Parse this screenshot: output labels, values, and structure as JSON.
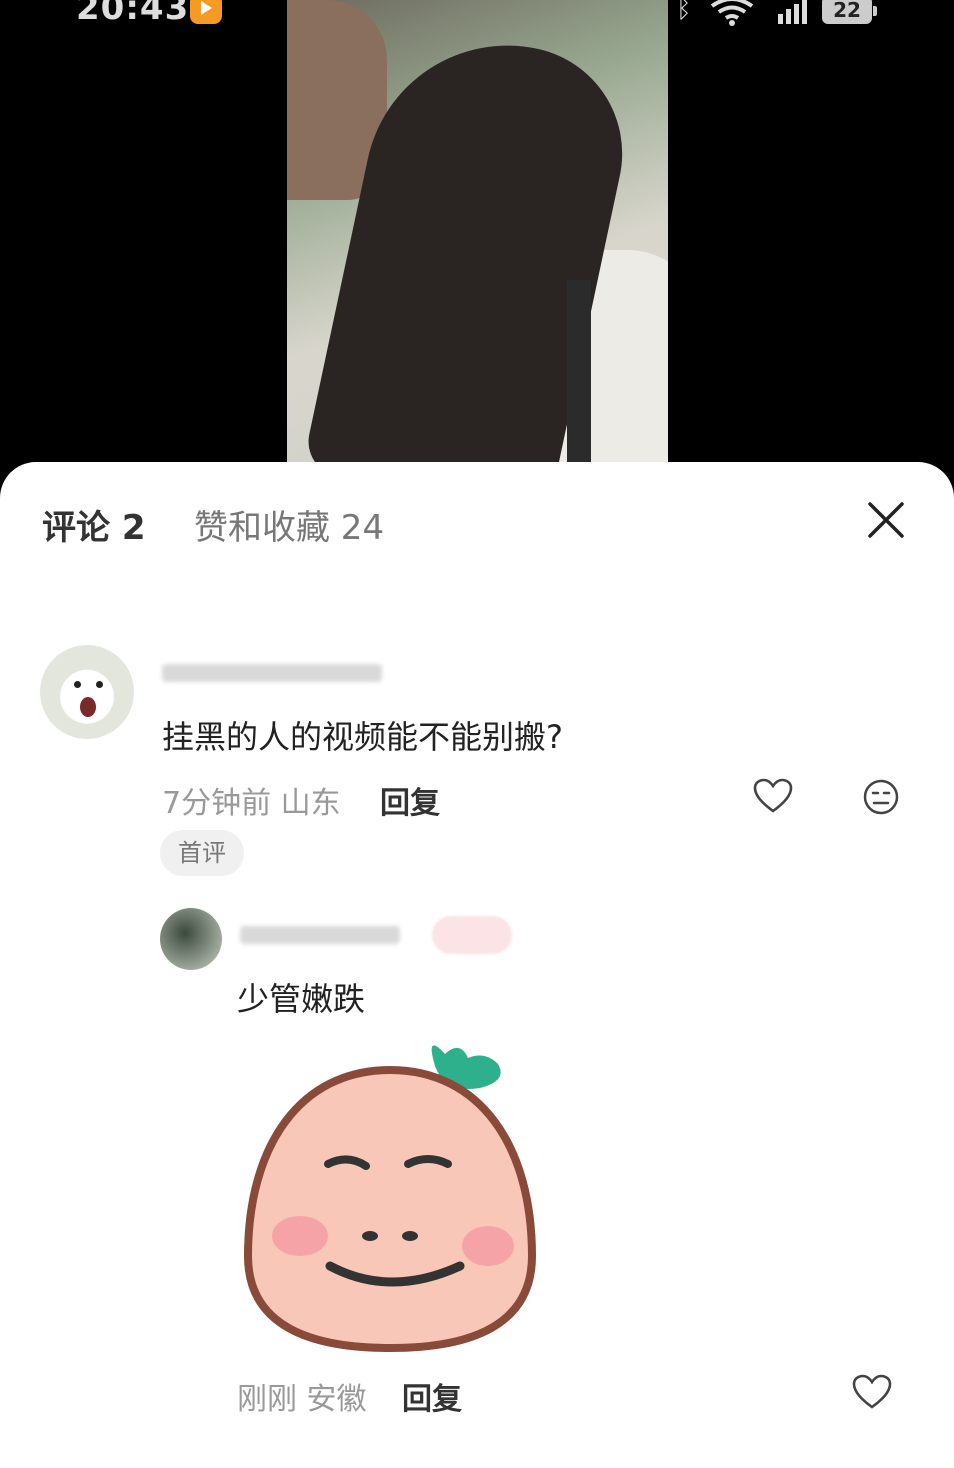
{
  "status_bar": {
    "time": "20:43",
    "battery": "22",
    "icons": [
      "app-icon",
      "alarm-icon",
      "bluetooth-icon",
      "wifi-icon",
      "signal-5g-icon"
    ]
  },
  "video": {
    "description_icon": "video-thumbnail"
  },
  "panel": {
    "tab_comments": "评论 2",
    "tab_likes": "赞和收藏 24",
    "close_icon": "close-icon"
  },
  "comments": [
    {
      "text": "挂黑的人的视频能不能别搬?",
      "meta": "7分钟前 山东",
      "reply_label": "回复",
      "badge": "首评"
    }
  ],
  "replies": [
    {
      "text": "少管嫩跌",
      "meta": "刚刚 安徽",
      "reply_label": "回复"
    }
  ],
  "colors": {
    "sheet_bg": "#ffffff",
    "text_primary": "#222222",
    "text_secondary": "#999999",
    "badge_bg": "#f0f0f0"
  }
}
